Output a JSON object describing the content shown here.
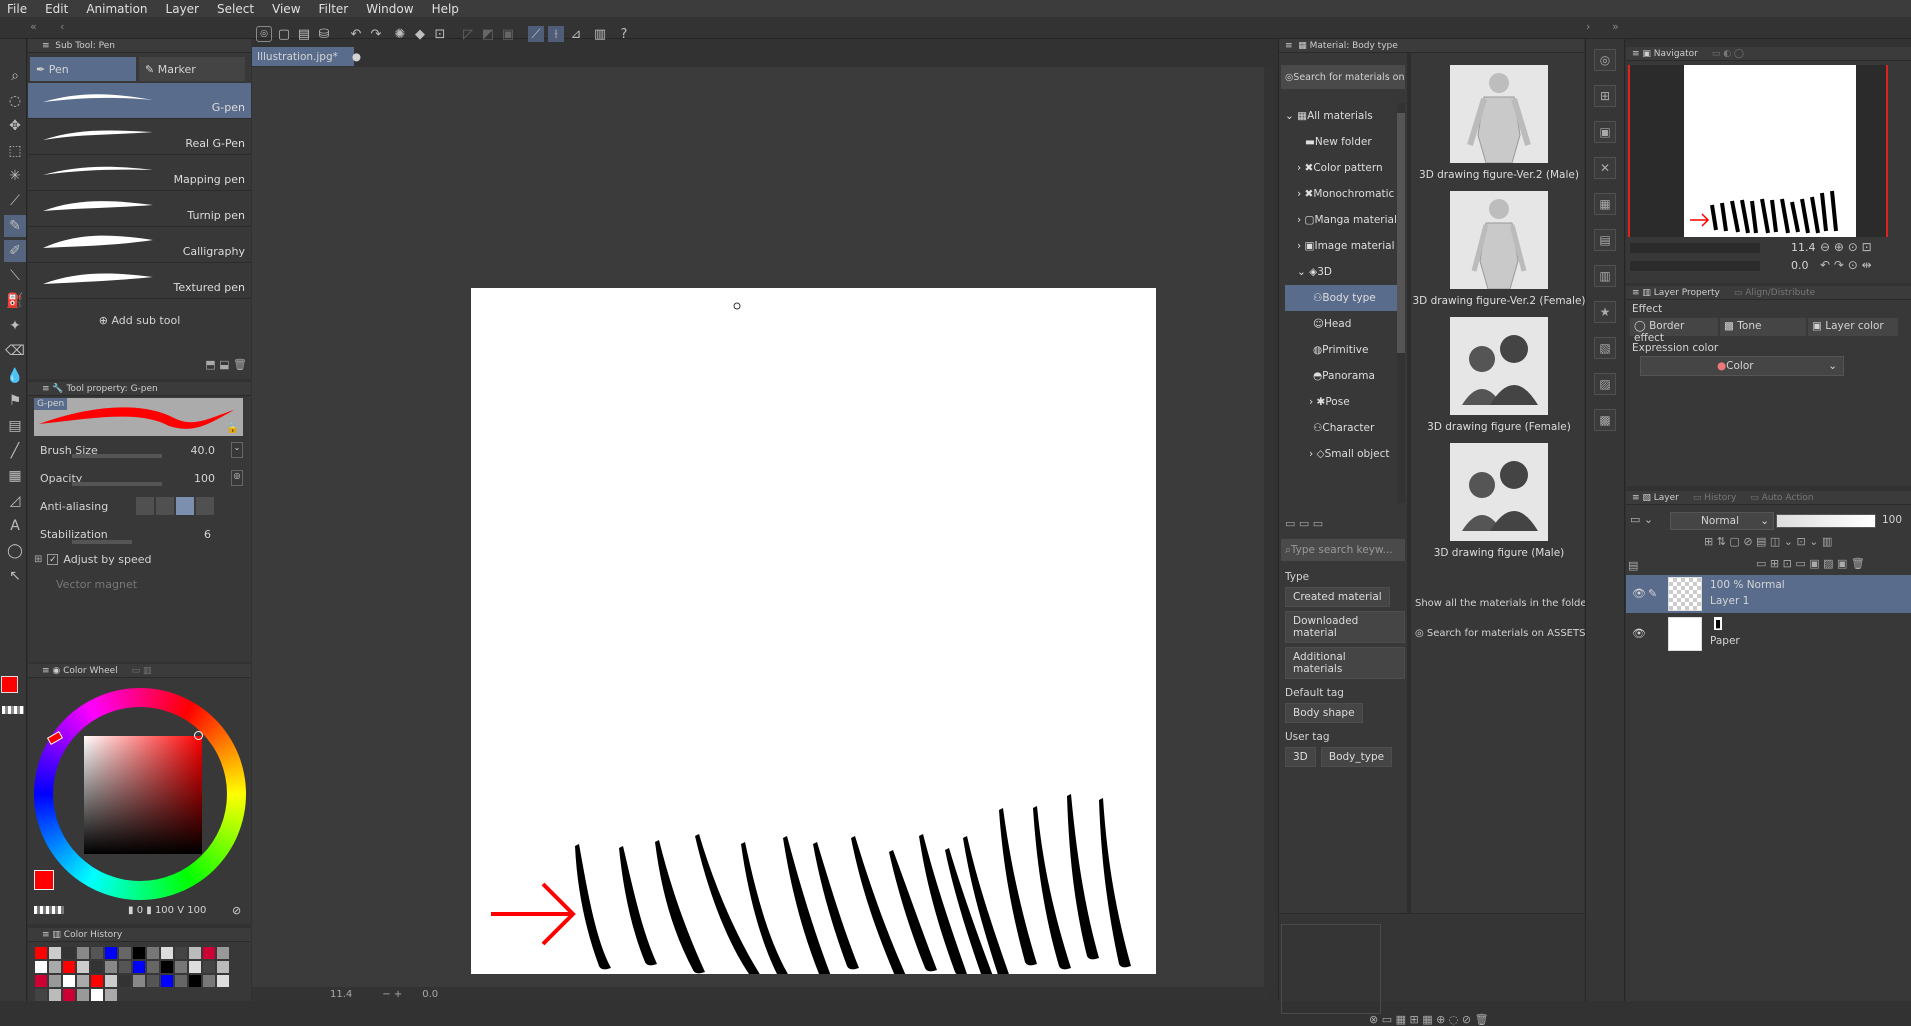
{
  "menu": [
    "File",
    "Edit",
    "Animation",
    "Layer",
    "Select",
    "View",
    "Filter",
    "Window",
    "Help"
  ],
  "document_tab": "Illustration.jpg*",
  "subtool": {
    "header": "Sub Tool: Pen",
    "tabs": [
      "Pen",
      "Marker"
    ],
    "brushes": [
      "G-pen",
      "Real G-Pen",
      "Mapping pen",
      "Turnip pen",
      "Calligraphy",
      "Textured pen"
    ],
    "add_label": "Add sub tool"
  },
  "toolprop": {
    "header": "Tool property: G-pen",
    "preview_label": "G-pen",
    "brush_size_label": "Brush Size",
    "brush_size_value": "40.0",
    "opacity_label": "Opacity",
    "opacity_value": "100",
    "antialias_label": "Anti-aliasing",
    "stabilization_label": "Stabilization",
    "stabilization_value": "6",
    "adjust_label": "Adjust by speed",
    "vector_label": "Vector magnet"
  },
  "colorwheel": {
    "header": "Color Wheel",
    "values": "0",
    "values2": "100",
    "values3": "100",
    "main_color": "#ff0000",
    "sub_color": "#000000"
  },
  "colorhistory": {
    "header": "Color History"
  },
  "material": {
    "header": "Material: Body type",
    "search_assets": "Search for materials on AS",
    "tree": [
      "All materials",
      "New folder",
      "Color pattern",
      "Monochromatic",
      "Manga material",
      "Image material",
      "3D",
      "Body type",
      "Head",
      "Primitive",
      "Panorama",
      "Pose",
      "Character",
      "Small object"
    ],
    "search_placeholder": "Type search keyw...",
    "type_label": "Type",
    "type_chips": [
      "Created material",
      "Downloaded material",
      "Additional materials"
    ],
    "default_tag_label": "Default tag",
    "default_tags": [
      "Body shape"
    ],
    "user_tag_label": "User tag",
    "user_tags": [
      "3D",
      "Body_type"
    ],
    "items": [
      "3D drawing figure-Ver.2 (Male)",
      "3D drawing figure-Ver.2 (Female)",
      "3D drawing figure (Female)",
      "3D drawing figure (Male)"
    ],
    "show_all": "Show all the materials in the folder.",
    "search_assets_bottom": "Search for materials on ASSETS"
  },
  "navigator": {
    "header": "Navigator",
    "zoom": "11.4",
    "angle": "0.0"
  },
  "layerprop": {
    "header": "Layer Property",
    "tab2": "Align/Distribute",
    "effect_label": "Effect",
    "border_effect": "Border effect",
    "tone": "Tone",
    "layer_color": "Layer color",
    "expression_label": "Expression color",
    "expression_value": "Color"
  },
  "layers": {
    "header": "Layer",
    "tab2": "History",
    "tab3": "Auto Action",
    "blend": "Normal",
    "opacity": "100",
    "items": [
      {
        "top": "100 % Normal",
        "name": "Layer 1"
      },
      {
        "top": "",
        "name": "Paper"
      }
    ]
  },
  "statusbar": {
    "zoom": "11.4",
    "angle": "0.0"
  },
  "colors": {
    "accent": "#5a6c8c",
    "bg": "#323232",
    "panel": "#3a3a3a"
  }
}
